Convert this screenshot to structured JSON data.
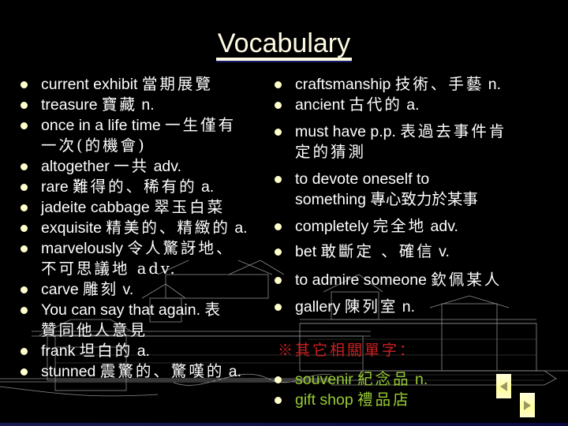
{
  "slide": {
    "title": "Vocabulary",
    "left_items": [
      {
        "en": "current exhibit ",
        "zh": "當期展覽",
        "pos": "",
        "cont": ""
      },
      {
        "en": "treasure ",
        "zh": "寶藏",
        "pos": " n.",
        "cont": ""
      },
      {
        "en": "once in a life time ",
        "zh": "一生僅有",
        "pos": "",
        "cont": "一次(的機會)"
      },
      {
        "en": "altogether  ",
        "zh": "一共",
        "pos": " adv.",
        "cont": ""
      },
      {
        "en": "rare ",
        "zh": "難得的、稀有的",
        "pos": " a.",
        "cont": ""
      },
      {
        "en": "jadeite cabbage ",
        "zh": "翠玉白菜",
        "pos": "",
        "cont": ""
      },
      {
        "en": "exquisite ",
        "zh": "精美的、精緻的",
        "pos": " a.",
        "cont": ""
      },
      {
        "en": "marvelously ",
        "zh": "令人驚訝地、",
        "pos": "",
        "cont": "不可思議地 adv."
      },
      {
        "en": "carve ",
        "zh": "雕刻",
        "pos": " v.",
        "cont": ""
      },
      {
        "en": "You can say that again. ",
        "zh": "表",
        "pos": "",
        "cont": "贊同他人意見"
      },
      {
        "en": "frank ",
        "zh": "坦白的",
        "pos": " a.",
        "cont": ""
      },
      {
        "en": "stunned ",
        "zh": "震驚的、驚嘆的",
        "pos": " a.",
        "cont": ""
      }
    ],
    "right_items": [
      {
        "en": "craftsmanship ",
        "zh": "技術、手藝",
        "pos": " n.",
        "cont": ""
      },
      {
        "en": "ancient ",
        "zh": "古代的",
        "pos": " a.",
        "cont": ""
      },
      {
        "en": "must have p.p. ",
        "zh": "表過去事件肯",
        "pos": "",
        "cont": "定的猜測"
      },
      {
        "en": "to devote oneself to",
        "zh": "",
        "pos": "",
        "cont": "something 專心致力於某事"
      },
      {
        "en": "completely ",
        "zh": "完全地",
        "pos": " adv.",
        "cont": ""
      },
      {
        "en": "bet ",
        "zh": "敢斷定 、確信",
        "pos": " v.",
        "cont": ""
      },
      {
        "en": "to admire someone ",
        "zh": "欽佩某人",
        "pos": "",
        "cont": ""
      },
      {
        "en": "gallery ",
        "zh": "陳列室",
        "pos": " n.",
        "cont": ""
      }
    ],
    "related_heading": "※其它相關單字：",
    "related_items": [
      {
        "en": "souvenir ",
        "zh": "紀念品",
        "pos": " n."
      },
      {
        "en": "gift shop ",
        "zh": "禮品店",
        "pos": ""
      }
    ],
    "nav": {
      "prev_icon": "triangle-left-icon",
      "next_icon": "triangle-right-icon"
    },
    "colors": {
      "text": "#ffffff",
      "title": "#fffbe3",
      "bullet": "#ffffcc",
      "related_heading": "#cc1f1f",
      "related_items": "#99cc33",
      "nav_button": "#ffff99"
    }
  }
}
